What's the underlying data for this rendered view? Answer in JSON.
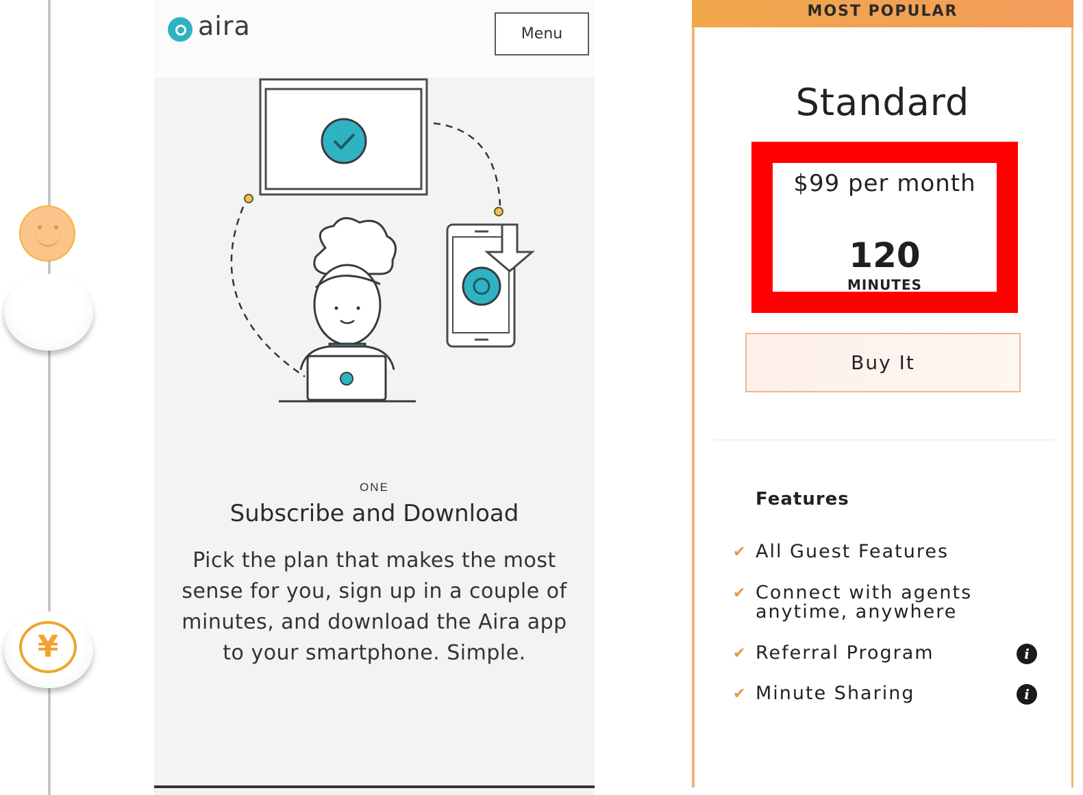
{
  "header": {
    "logo_text": "aira",
    "menu_label": "Menu"
  },
  "step": {
    "number_label": "ONE",
    "title": "Subscribe and Download",
    "body": "Pick the plan that makes the most sense for you, sign up in a couple of minutes, and download the Aira app to your smartphone. Simple."
  },
  "plan": {
    "banner": "MOST POPULAR",
    "name": "Standard",
    "price": "$99 per month",
    "minutes_value": "120",
    "minutes_unit": "MINUTES",
    "buy_label": "Buy It",
    "features_heading": "Features",
    "features": [
      {
        "label": "All Guest Features",
        "has_info": false
      },
      {
        "label": "Connect with agents anytime, anywhere",
        "has_info": false
      },
      {
        "label": "Referral Program",
        "has_info": true
      },
      {
        "label": "Minute Sharing",
        "has_info": true
      }
    ]
  },
  "timeline": {
    "icons": [
      "smiley-icon",
      "blank-circle-icon",
      "yen-icon"
    ],
    "yen_symbol": "¥"
  },
  "icons": {
    "check": "✔",
    "info": "i"
  },
  "colors": {
    "accent_teal": "#2fb3c3",
    "accent_orange": "#f0a74a",
    "highlight_red": "#ff0000"
  }
}
